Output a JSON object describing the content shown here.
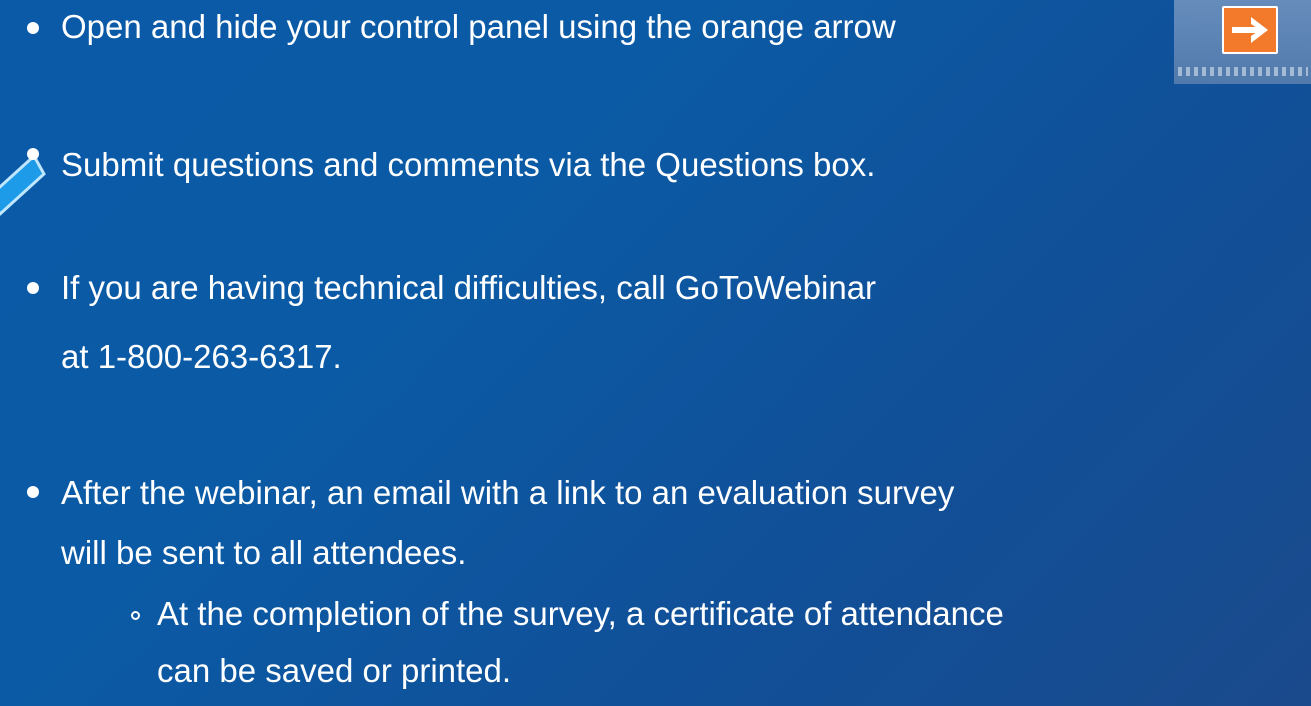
{
  "bullets": [
    {
      "text": "Open and hide your control panel using the orange arrow"
    },
    {
      "text": "Submit questions and comments via the Questions box."
    },
    {
      "lines": [
        "If you are having technical difficulties, call GoToWebinar",
        "at 1-800-263-6317."
      ]
    },
    {
      "lines": [
        "After the webinar, an email with a link to an evaluation survey",
        "will be sent to all attendees."
      ]
    }
  ],
  "sub_bullets": [
    {
      "lines": [
        "At the completion of the survey, a certificate of attendance",
        "can be saved or printed."
      ]
    }
  ],
  "icons": {
    "toggle": "right-arrow-icon",
    "pointer": "pointer-arrow-icon"
  },
  "colors": {
    "background": "#0b5aa5",
    "accent": "#f37a2a",
    "text": "#ffffff"
  }
}
